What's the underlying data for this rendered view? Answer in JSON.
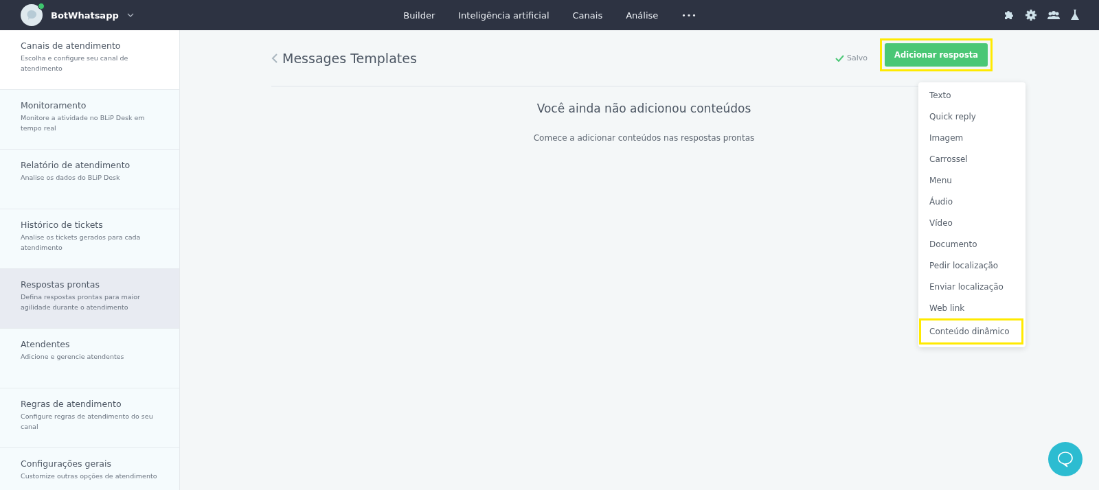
{
  "topbar": {
    "bot_name": "BotWhatsapp",
    "online": true,
    "nav": [
      {
        "label": "Builder"
      },
      {
        "label": "Inteligência artificial"
      },
      {
        "label": "Canais"
      },
      {
        "label": "Análise"
      }
    ],
    "more": "•••"
  },
  "sidebar": {
    "items": [
      {
        "title": "Canais de atendimento",
        "description": "Escolha e configure seu canal de atendimento",
        "selected": false
      },
      {
        "title": "Monitoramento",
        "description": "Monitore a atividade no BLiP Desk em tempo real",
        "selected": false
      },
      {
        "title": "Relatório de atendimento",
        "description": "Analise os dados do BLiP Desk",
        "selected": false
      },
      {
        "title": "Histórico de tickets",
        "description": "Analise os tickets gerados para cada atendimento",
        "selected": false
      },
      {
        "title": "Respostas prontas",
        "description": "Defina respostas prontas para maior agilidade durante o atendimento",
        "selected": true
      },
      {
        "title": "Atendentes",
        "description": "Adicione e gerencie atendentes",
        "selected": false
      },
      {
        "title": "Regras de atendimento",
        "description": "Configure regras de atendimento do seu canal",
        "selected": false
      },
      {
        "title": "Configurações gerais",
        "description": "Customize outras opções de atendimento",
        "selected": false
      }
    ]
  },
  "header": {
    "title": "Messages Templates",
    "status": "Salvo",
    "add_button": {
      "label": "Adicionar resposta",
      "highlighted": true
    }
  },
  "empty_state": {
    "title": "Você ainda não adicionou conteúdos",
    "subtitle": "Comece a adicionar conteúdos nas respostas prontas"
  },
  "menu": {
    "items": [
      {
        "label": "Texto",
        "highlighted": false
      },
      {
        "label": "Quick reply",
        "highlighted": false
      },
      {
        "label": "Imagem",
        "highlighted": false
      },
      {
        "label": "Carrossel",
        "highlighted": false
      },
      {
        "label": "Menu",
        "highlighted": false
      },
      {
        "label": "Áudio",
        "highlighted": false
      },
      {
        "label": "Vídeo",
        "highlighted": false
      },
      {
        "label": "Documento",
        "highlighted": false
      },
      {
        "label": "Pedir localização",
        "highlighted": false
      },
      {
        "label": "Enviar localização",
        "highlighted": false
      },
      {
        "label": "Web link",
        "highlighted": false
      },
      {
        "label": "Conteúdo dinâmico",
        "highlighted": true
      }
    ]
  }
}
